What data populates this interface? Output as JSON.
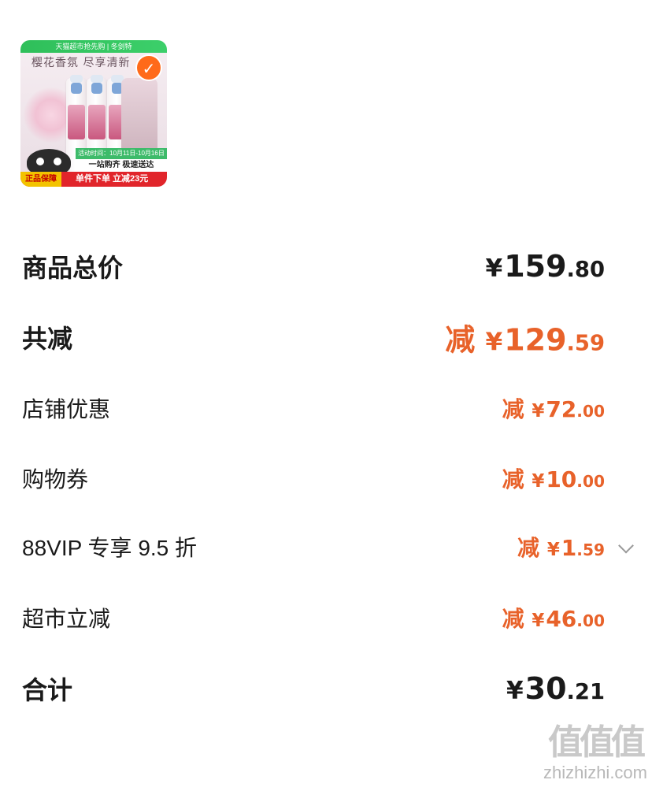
{
  "product": {
    "banner": "天猫超市抢先购 | 冬剑特",
    "slogan": "樱花香氛 尽享清新",
    "strip": "活动时间：10月11日-10月16日",
    "sub_banner": "一站购齐  极速送达",
    "authentic": "正品保障",
    "promo": "单件下单 立减23元",
    "selected": true,
    "check_icon": "check-icon"
  },
  "rows": {
    "subtotal": {
      "label": "商品总价",
      "yuan": "¥",
      "int": "159",
      "dec": ".80"
    },
    "total_discount": {
      "label": "共减",
      "prefix": "减",
      "yuan": "¥",
      "int": "129",
      "dec": ".59"
    },
    "shop_discount": {
      "label": "店铺优惠",
      "prefix": "减",
      "yuan": "¥",
      "int": "72",
      "dec": ".00"
    },
    "coupon": {
      "label": "购物券",
      "prefix": "减",
      "yuan": "¥",
      "int": "10",
      "dec": ".00"
    },
    "vip": {
      "label": "88VIP 专享 9.5 折",
      "prefix": "减",
      "yuan": "¥",
      "int": "1",
      "dec": ".59"
    },
    "market": {
      "label": "超市立减",
      "prefix": "减",
      "yuan": "¥",
      "int": "46",
      "dec": ".00"
    },
    "total": {
      "label": "合计",
      "yuan": "¥",
      "int": "30",
      "dec": ".21"
    }
  },
  "colors": {
    "discount": "#e8622a",
    "text": "#1a1a1a"
  },
  "watermark": {
    "title": "值值值",
    "url": "zhizhizhi.com"
  }
}
